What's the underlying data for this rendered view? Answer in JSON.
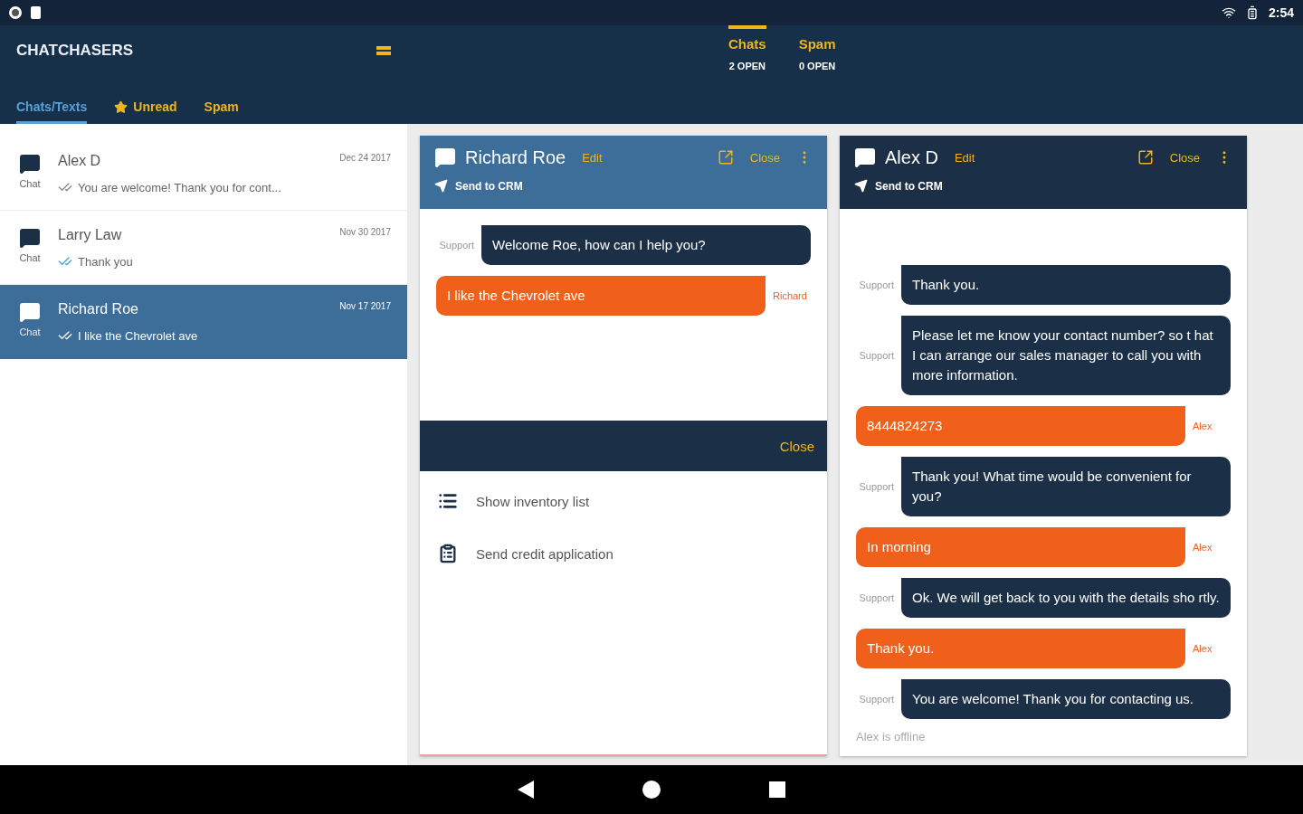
{
  "status_bar": {
    "time": "2:54"
  },
  "app": {
    "title": "CHATCHASERS"
  },
  "list_tabs": [
    {
      "label": "Chats/Texts",
      "selected": true,
      "starred": false
    },
    {
      "label": "Unread",
      "selected": false,
      "starred": true
    },
    {
      "label": "Spam",
      "selected": false,
      "starred": false
    }
  ],
  "top_tabs": [
    {
      "label": "Chats",
      "count": "2 OPEN",
      "selected": true
    },
    {
      "label": "Spam",
      "count": "0 OPEN",
      "selected": false
    }
  ],
  "conversations": [
    {
      "name": "Alex D",
      "type": "Chat",
      "date": "Dec 24 2017",
      "preview": "You are welcome! Thank you for cont...",
      "read": false,
      "selected": false
    },
    {
      "name": "Larry Law",
      "type": "Chat",
      "date": "Nov 30 2017",
      "preview": "Thank you",
      "read": true,
      "selected": false
    },
    {
      "name": "Richard Roe",
      "type": "Chat",
      "date": "Nov 17 2017",
      "preview": "I like the Chevrolet ave",
      "read": false,
      "selected": true
    }
  ],
  "chat_windows": [
    {
      "name": "Richard Roe",
      "edit": "Edit",
      "close": "Close",
      "send_to_crm": "Send to CRM",
      "focused": true,
      "messages": [
        {
          "kind": "agent",
          "sender": "Support",
          "text": "Welcome Roe, how can I help you?"
        },
        {
          "kind": "customer",
          "sender": "Richard",
          "text": "I like the Chevrolet ave"
        }
      ],
      "actions_bar": {
        "close": "Close"
      },
      "actions": [
        {
          "kind": "list",
          "label": "Show inventory list"
        },
        {
          "kind": "clipboard",
          "label": "Send credit application"
        }
      ]
    },
    {
      "name": "Alex D",
      "edit": "Edit",
      "close": "Close",
      "send_to_crm": "Send to CRM",
      "focused": false,
      "messages": [
        {
          "kind": "agent",
          "sender": "Support",
          "text": "Thank you."
        },
        {
          "kind": "agent",
          "sender": "Support",
          "text": "Please let me know your contact number? so t hat I can arrange our sales manager to call you with more information."
        },
        {
          "kind": "customer",
          "sender": "Alex",
          "text": "8444824273"
        },
        {
          "kind": "agent",
          "sender": "Support",
          "text": "Thank you! What time would be convenient for you?"
        },
        {
          "kind": "customer",
          "sender": "Alex",
          "text": "In morning"
        },
        {
          "kind": "agent",
          "sender": "Support",
          "text": "Ok. We will get back to you with the details sho rtly."
        },
        {
          "kind": "customer",
          "sender": "Alex",
          "text": "Thank you."
        },
        {
          "kind": "agent",
          "sender": "Support",
          "text": "You are welcome! Thank you for contacting us."
        }
      ],
      "status": "Alex is offline"
    }
  ]
}
